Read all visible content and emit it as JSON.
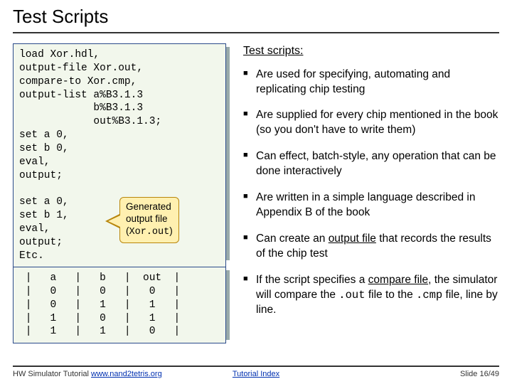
{
  "title": "Test Scripts",
  "code": "load Xor.hdl,\noutput-file Xor.out,\ncompare-to Xor.cmp,\noutput-list a%B3.1.3\n            b%B3.1.3\n            out%B3.1.3;\nset a 0,\nset b 0,\neval,\noutput;\n\nset a 0,\nset b 1,\neval,\noutput;\nEtc.",
  "callout": {
    "l1": "Generated",
    "l2": "output file",
    "l3": "(Xor.out)"
  },
  "table": " |   a   |   b   |  out  |\n |   0   |   0   |   0   |\n |   0   |   1   |   1   |\n |   1   |   0   |   1   |\n |   1   |   1   |   0   |",
  "right": {
    "heading": "Test scripts:",
    "b1": "Are used for specifying, automating and replicating chip testing",
    "b2": "Are supplied for every chip mentioned in the book (so you don't have to write them)",
    "b3": "Can effect, batch-style, any operation that can be done interactively",
    "b4": "Are written in a simple language described in Appendix B of the book",
    "b5a": "Can create an ",
    "b5u": "output file",
    "b5b": " that records the results of the chip test",
    "b6a": "If the script specifies a ",
    "b6u": "compare file",
    "b6b": ", the simulator will compare the ",
    "b6c": ".out",
    "b6d": " file to the ",
    "b6e": ".cmp",
    "b6f": " file, line by line."
  },
  "footer": {
    "left_text": "HW Simulator Tutorial ",
    "left_link": "www.nand2tetris.org",
    "center": "Tutorial Index",
    "right": "Slide 16/49"
  }
}
